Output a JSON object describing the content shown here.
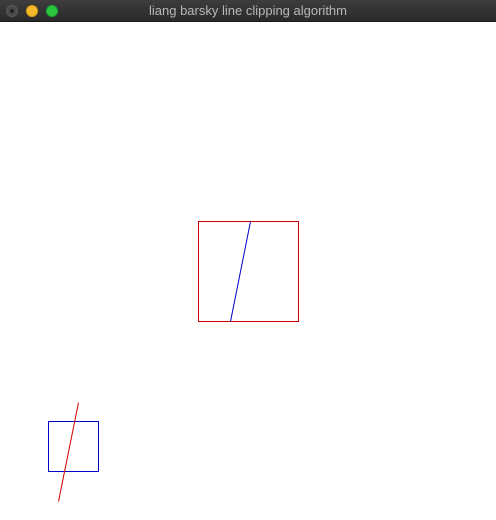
{
  "window": {
    "title": "liang barsky line clipping algorithm"
  },
  "icons": {
    "close": "close-button-icon",
    "minimize": "minimize-button-icon",
    "zoom": "zoom-button-icon"
  },
  "colors": {
    "titlebar": "#2f2f2f",
    "title_text": "#b8b8b8",
    "canvas_background": "#ffffff",
    "clip_window_stroke": "#d00000",
    "clipped_line_stroke": "#0000c8",
    "original_window_stroke": "#0000c8",
    "original_line_stroke": "#d00000"
  }
}
